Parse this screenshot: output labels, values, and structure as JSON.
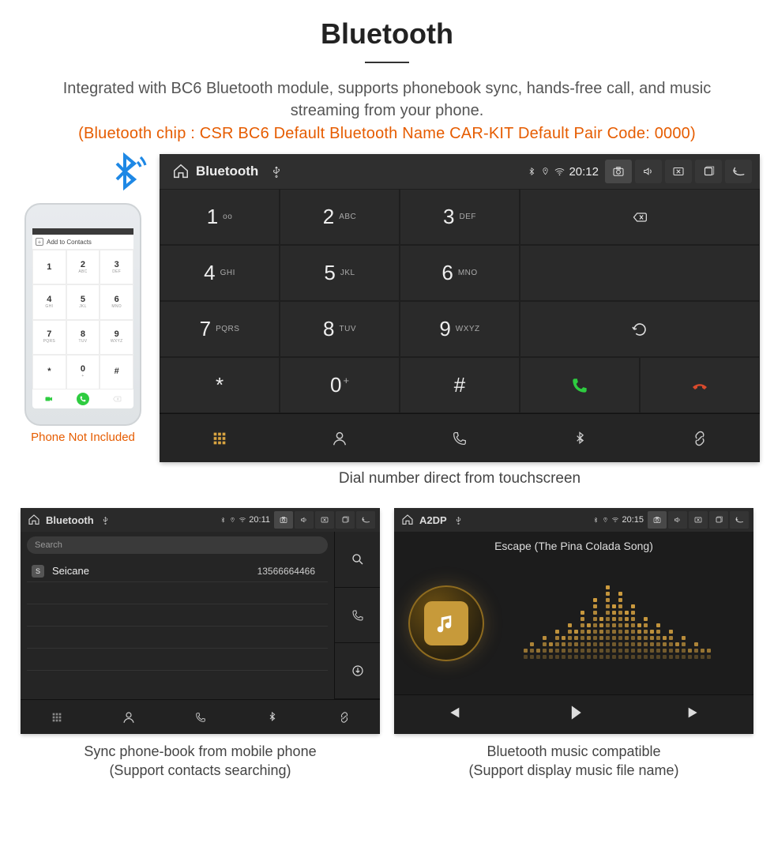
{
  "page": {
    "title": "Bluetooth",
    "description": "Integrated with BC6 Bluetooth module, supports phonebook sync, hands-free call, and music streaming from your phone.",
    "specs": "(Bluetooth chip : CSR BC6    Default Bluetooth Name CAR-KIT    Default Pair Code: 0000)"
  },
  "phone": {
    "disclaimer": "Phone Not Included",
    "add_label": "Add to Contacts",
    "keys": [
      {
        "num": "1",
        "sub": ""
      },
      {
        "num": "2",
        "sub": "ABC"
      },
      {
        "num": "3",
        "sub": "DEF"
      },
      {
        "num": "4",
        "sub": "GHI"
      },
      {
        "num": "5",
        "sub": "JKL"
      },
      {
        "num": "6",
        "sub": "MNO"
      },
      {
        "num": "7",
        "sub": "PQRS"
      },
      {
        "num": "8",
        "sub": "TUV"
      },
      {
        "num": "9",
        "sub": "WXYZ"
      },
      {
        "num": "*",
        "sub": ""
      },
      {
        "num": "0",
        "sub": "+"
      },
      {
        "num": "#",
        "sub": ""
      }
    ]
  },
  "dialer": {
    "status": {
      "title": "Bluetooth",
      "time": "20:12"
    },
    "keys": [
      {
        "num": "1",
        "sub": "oo"
      },
      {
        "num": "2",
        "sub": "ABC"
      },
      {
        "num": "3",
        "sub": "DEF"
      },
      {
        "num": "4",
        "sub": "GHI"
      },
      {
        "num": "5",
        "sub": "JKL"
      },
      {
        "num": "6",
        "sub": "MNO"
      },
      {
        "num": "7",
        "sub": "PQRS"
      },
      {
        "num": "8",
        "sub": "TUV"
      },
      {
        "num": "9",
        "sub": "WXYZ"
      },
      {
        "num": "*",
        "sub": ""
      },
      {
        "num": "0",
        "sub": "+",
        "supPlus": true
      },
      {
        "num": "#",
        "sub": ""
      }
    ],
    "caption": "Dial number direct from touchscreen"
  },
  "phonebook": {
    "status": {
      "title": "Bluetooth",
      "time": "20:11"
    },
    "search_placeholder": "Search",
    "contact": {
      "initial": "S",
      "name": "Seicane",
      "number": "13566664466"
    },
    "caption_line1": "Sync phone-book from mobile phone",
    "caption_line2": "(Support contacts searching)"
  },
  "music": {
    "status": {
      "title": "A2DP",
      "time": "20:15"
    },
    "track_title": "Escape (The Pina Colada Song)",
    "eq_heights": [
      2,
      3,
      2,
      4,
      3,
      5,
      4,
      6,
      5,
      8,
      6,
      10,
      7,
      12,
      9,
      11,
      8,
      9,
      6,
      7,
      5,
      6,
      4,
      5,
      3,
      4,
      2,
      3,
      2,
      2
    ],
    "caption_line1": "Bluetooth music compatible",
    "caption_line2": "(Support display music file name)"
  },
  "colors": {
    "accent": "#d9a441",
    "orange": "#e65c00",
    "green": "#2ecc40",
    "red": "#d94a2c"
  }
}
